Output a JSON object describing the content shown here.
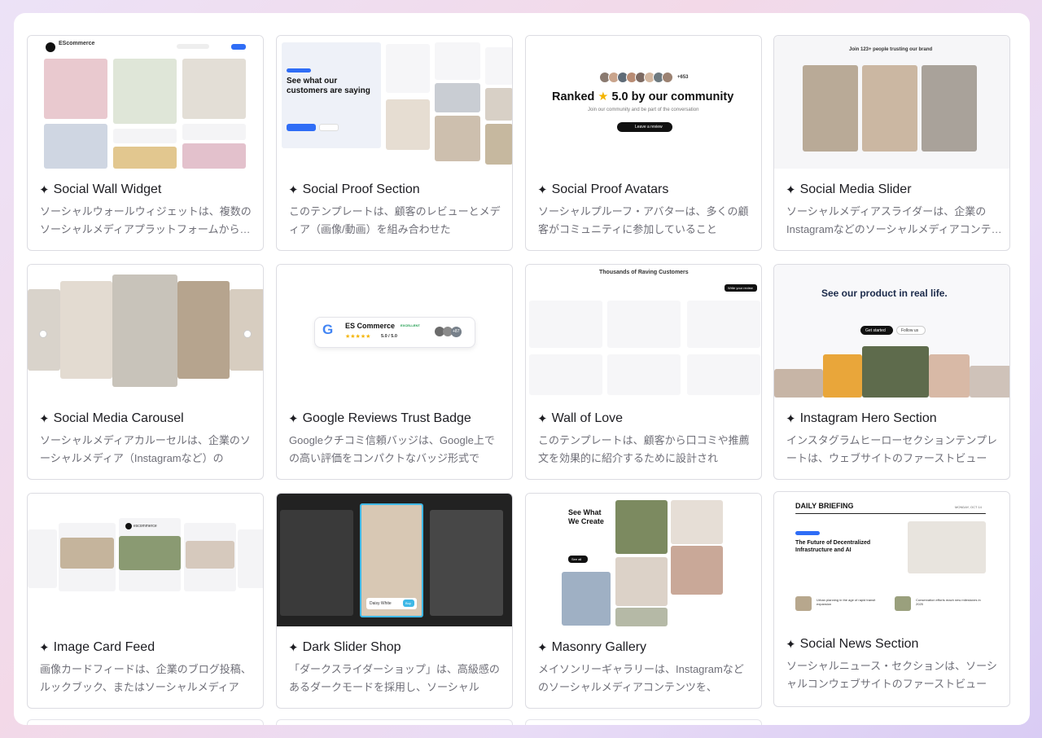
{
  "cards": [
    {
      "title": "Social Wall Widget",
      "desc": "ソーシャルウォールウィジェットは、複数のソーシャルメディアプラットフォームからの投稿を",
      "preview": {
        "brand": "EScommerce"
      }
    },
    {
      "title": "Social Proof Section",
      "desc": "このテンプレートは、顧客のレビューとメディア（画像/動画）を組み合わせた",
      "preview": {
        "heading": "See what our customers are saying"
      }
    },
    {
      "title": "Social Proof Avatars",
      "desc": "ソーシャルプルーフ・アバターは、多くの顧客がコミュニティに参加していること",
      "preview": {
        "count": "+653",
        "heading_pre": "Ranked",
        "heading_post": "5.0 by our community",
        "sub": "Join our community and be part of the conversation",
        "button": "Leave a review"
      }
    },
    {
      "title": "Social Media Slider",
      "desc": "ソーシャルメディアスライダーは、企業のInstagramなどのソーシャルメディアコンテンツを",
      "preview": {
        "heading": "Join 123+ people trusting our brand"
      }
    },
    {
      "title": "Social Media Carousel",
      "desc": "ソーシャルメディアカルーセルは、企業のソーシャルメディア（Instagramなど）の",
      "preview": {}
    },
    {
      "title": "Google Reviews Trust Badge",
      "desc": "Googleクチコミ信頼バッジは、Google上での高い評価をコンパクトなバッジ形式で",
      "preview": {
        "brand": "ES Commerce",
        "tag": "EXCELLENT",
        "score": "5.0 / 5.0",
        "more": "+87"
      }
    },
    {
      "title": "Wall of Love",
      "desc": "このテンプレートは、顧客から口コミや推薦文を効果的に紹介するために設計され",
      "preview": {
        "heading": "Thousands of Raving Customers",
        "button": "Write your review"
      }
    },
    {
      "title": "Instagram Hero Section",
      "desc": "インスタグラムヒーローセクションテンプレートは、ウェブサイトのファーストビュー",
      "preview": {
        "heading": "See our product in real life.",
        "button1": "Get started",
        "button2": "Follow us"
      }
    },
    {
      "title": "Image Card Feed",
      "desc": "画像カードフィードは、企業のブログ投稿、ルックブック、またはソーシャルメディア",
      "preview": {
        "handle": "escommerce"
      }
    },
    {
      "title": "Dark Slider Shop",
      "desc": "「ダークスライダーショップ」は、高級感のあるダークモードを採用し、ソーシャル",
      "preview": {
        "product": "Daisy White",
        "cta": "Buy"
      }
    },
    {
      "title": "Masonry Gallery",
      "desc": "メイソンリーギャラリーは、Instagramなどのソーシャルメディアコンテンツを、",
      "preview": {
        "heading": "See What We Create",
        "button": "See all"
      }
    },
    {
      "title": "Social News Section",
      "desc": "ソーシャルニュース・セクションは、ソーシャルコンウェブサイトのファーストビュー",
      "preview": {
        "masthead": "DAILY BRIEFING",
        "date": "MONDAY, OCT 14",
        "headline": "The Future of Decentralized Infrastructure and AI",
        "story1": "Urban planning in the age of rapid transit expansion",
        "story2": "Conservation efforts reach new milestones in 2025"
      }
    }
  ],
  "colors": {
    "accent": "#2f6df6",
    "star": "#f4b400",
    "text": "#1d1d22",
    "muted": "#6f6f78"
  }
}
